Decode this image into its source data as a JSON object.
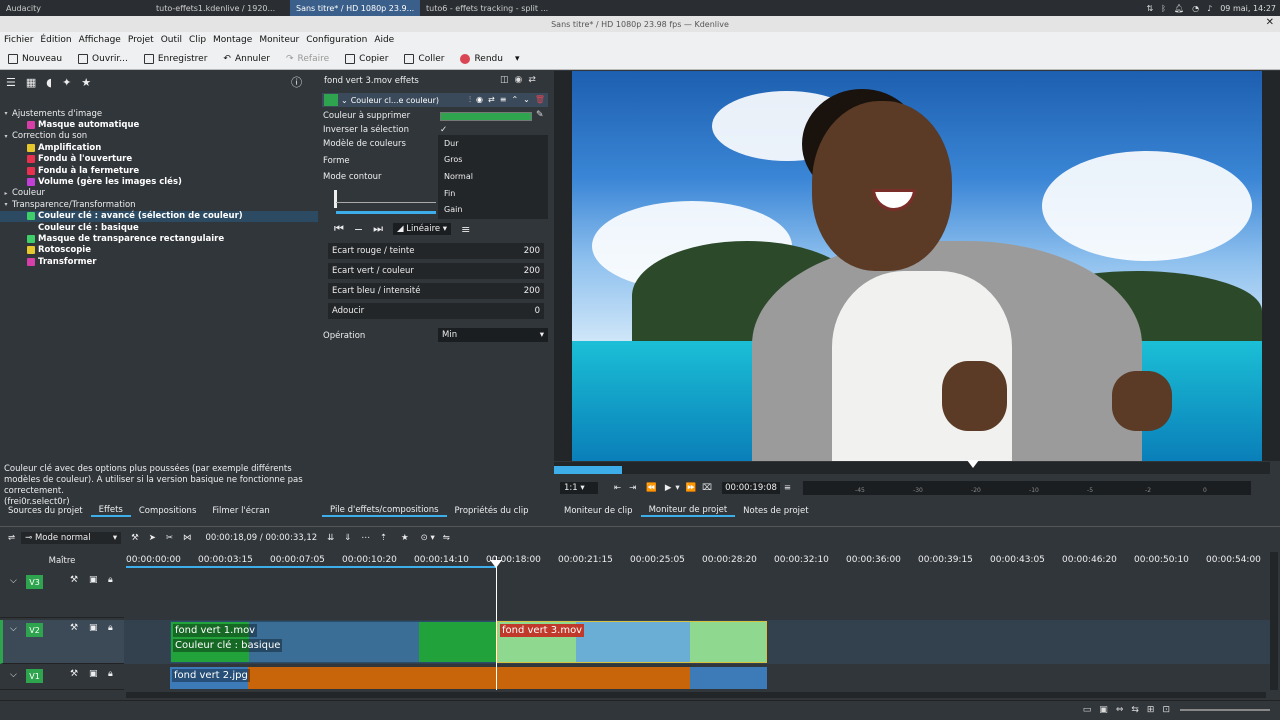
{
  "taskbar": {
    "items": [
      {
        "label": "Audacity",
        "active": false
      },
      {
        "label": "tuto-effets1.kdenlive / 1920...",
        "active": false
      },
      {
        "label": "Sans titre* / HD 1080p 23.9...",
        "active": true
      },
      {
        "label": "tuto6 - effets tracking - split ...",
        "active": false
      }
    ],
    "clock": "09 mai, 14:27"
  },
  "window_title": "Sans titre* / HD 1080p 23.98 fps — Kdenlive",
  "menu": [
    "Fichier",
    "Édition",
    "Affichage",
    "Projet",
    "Outil",
    "Clip",
    "Montage",
    "Moniteur",
    "Configuration",
    "Aide"
  ],
  "toolbar": {
    "new": "Nouveau",
    "open": "Ouvrir...",
    "save": "Enregistrer",
    "undo": "Annuler",
    "redo": "Refaire",
    "copy": "Copier",
    "paste": "Coller",
    "render": "Rendu"
  },
  "effects_tree": [
    {
      "type": "cat",
      "label": "Ajustements d'image"
    },
    {
      "type": "eff",
      "label": "Masque automatique",
      "color": "#d63fa8"
    },
    {
      "type": "cat",
      "label": "Correction du son"
    },
    {
      "type": "eff",
      "label": "Amplification",
      "color": "#e6c82e"
    },
    {
      "type": "eff",
      "label": "Fondu à l'ouverture",
      "color": "#e6314f"
    },
    {
      "type": "eff",
      "label": "Fondu à la fermeture",
      "color": "#e6314f"
    },
    {
      "type": "eff",
      "label": "Volume (gère les images clés)",
      "color": "#c23fd6"
    },
    {
      "type": "cat",
      "label": "Couleur"
    },
    {
      "type": "cat",
      "label": "Transparence/Transformation"
    },
    {
      "type": "eff",
      "label": "Couleur clé : avancé (sélection de couleur)",
      "color": "#3fcf6a",
      "selected": true
    },
    {
      "type": "eff",
      "label": "Couleur clé : basique",
      "color": ""
    },
    {
      "type": "eff",
      "label": "Masque de transparence rectangulaire",
      "color": "#3fcf6a"
    },
    {
      "type": "eff",
      "label": "Rotoscopie",
      "color": "#e6c82e"
    },
    {
      "type": "eff",
      "label": "Transformer",
      "color": "#d63fa8"
    }
  ],
  "effect_description": "Couleur clé avec des options plus poussées (par exemple différents modèles de couleur). A utiliser si la version basique ne fonctionne pas correctement.\n(frei0r.select0r)",
  "left_tabs": [
    "Sources du projet",
    "Effets",
    "Compositions",
    "Filmer l'écran"
  ],
  "effect_stack": {
    "title": "fond vert 3.mov effets",
    "effect_name": "Couleur cl...e couleur)",
    "color_to_remove_label": "Couleur à supprimer",
    "invert_label": "Inverser la sélection",
    "invert_check": "✓",
    "color_model_label": "Modèle de couleurs",
    "shape_label": "Forme",
    "edge_mode_label": "Mode contour",
    "dropdown_options": [
      "Dur",
      "Gros",
      "Normal",
      "Fin",
      "Gain"
    ],
    "interp": "Linéaire",
    "sliders": [
      {
        "label": "Ecart rouge / teinte",
        "value": "200"
      },
      {
        "label": "Ecart vert / couleur",
        "value": "200"
      },
      {
        "label": "Ecart bleu / intensité",
        "value": "200"
      },
      {
        "label": "Adoucir",
        "value": "0"
      }
    ],
    "operation_label": "Opération",
    "operation_value": "Min"
  },
  "middle_tabs": [
    "Pile d'effets/compositions",
    "Propriétés du clip"
  ],
  "monitor": {
    "zoom": "1:1",
    "timecode": "00:00:19:08",
    "db_scale": [
      "-45",
      "-30",
      "-20",
      "-10",
      "-5",
      "-2",
      "0"
    ],
    "tabs": [
      "Moniteur de clip",
      "Moniteur de projet",
      "Notes de projet"
    ]
  },
  "timeline": {
    "mode": "Mode normal",
    "position": "00:00:18,09 / 00:00:33,12",
    "master_label": "Maître",
    "ticks": [
      "00:00:00:00",
      "00:00:03:15",
      "00:00:07:05",
      "00:00:10:20",
      "00:00:14:10",
      "00:00:18:00",
      "00:00:21:15",
      "00:00:25:05",
      "00:00:28:20",
      "00:00:32:10",
      "00:00:36:00",
      "00:00:39:15",
      "00:00:43:05",
      "00:00:46:20",
      "00:00:50:10",
      "00:00:54:00"
    ],
    "tracks": [
      "V3",
      "V2",
      "V1"
    ],
    "clips": {
      "c1": "fond vert 1.mov",
      "c1_effect": "Couleur clé : basique",
      "c2": "fond vert 3.mov",
      "c3": "fond vert 2.jpg"
    }
  }
}
